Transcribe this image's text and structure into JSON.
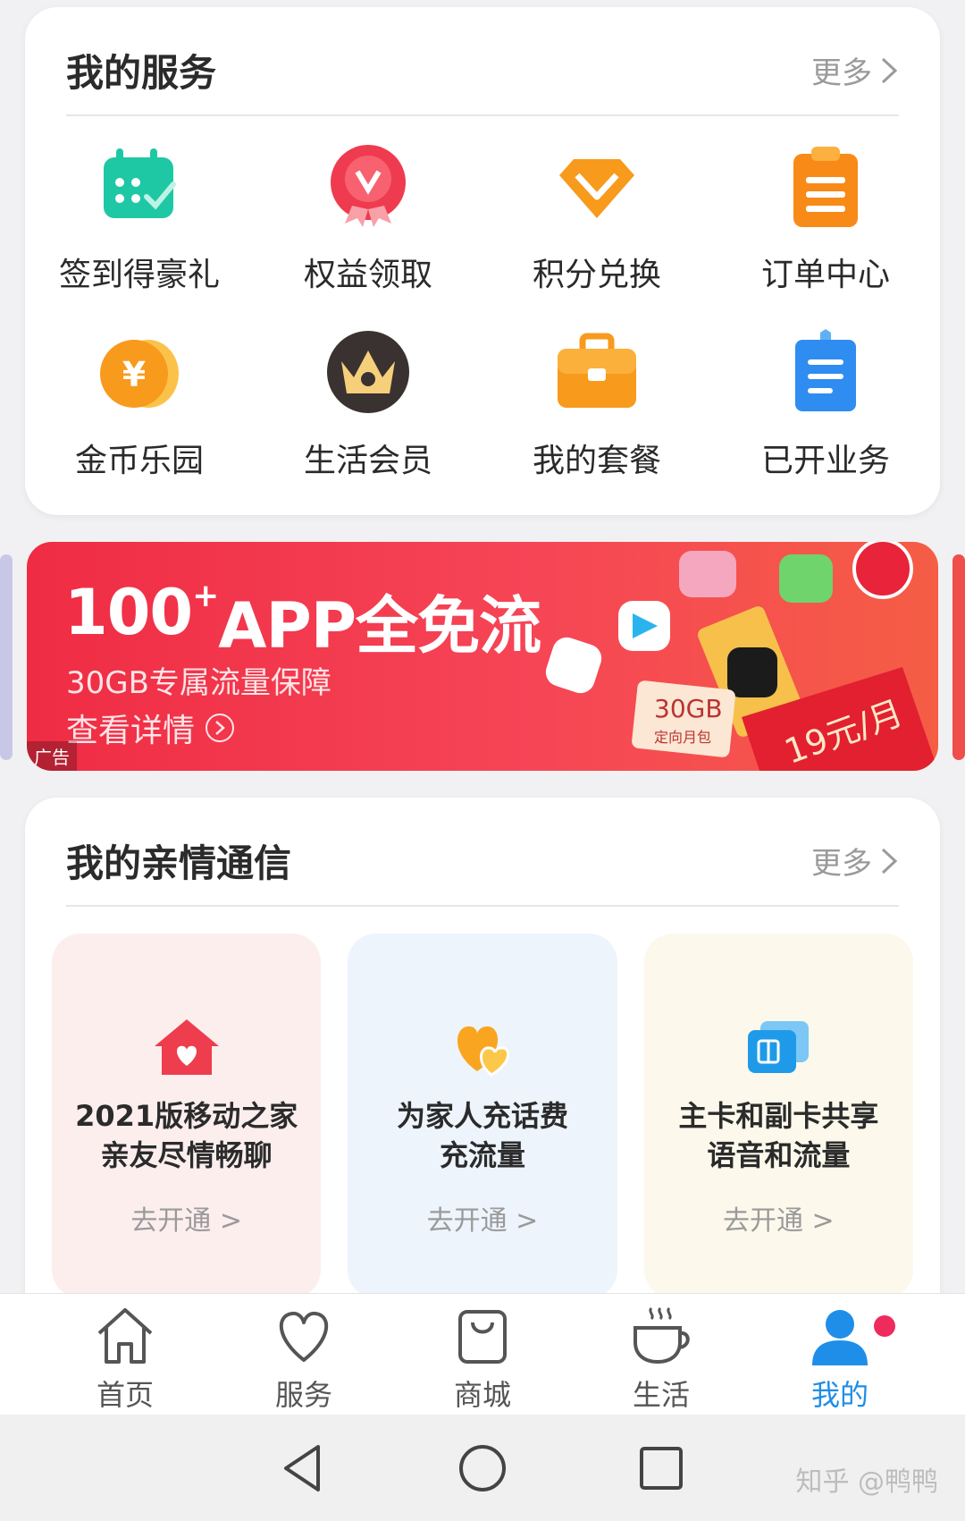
{
  "services": {
    "title": "我的服务",
    "more": "更多",
    "items": [
      {
        "label": "签到得豪礼",
        "icon": "calendar-check-icon"
      },
      {
        "label": "权益领取",
        "icon": "rights-badge-icon"
      },
      {
        "label": "积分兑换",
        "icon": "diamond-icon"
      },
      {
        "label": "订单中心",
        "icon": "clipboard-icon"
      },
      {
        "label": "金币乐园",
        "icon": "coin-icon"
      },
      {
        "label": "生活会员",
        "icon": "crown-icon"
      },
      {
        "label": "我的套餐",
        "icon": "briefcase-icon"
      },
      {
        "label": "已开业务",
        "icon": "document-icon"
      }
    ]
  },
  "banner": {
    "title_main": "100",
    "title_sup": "+",
    "title_rest": "APP全免流",
    "subtitle": "30GB专属流量保障",
    "detail": "查看详情",
    "ad_label": "广告",
    "price": "19元/月",
    "gb_label": "30GB",
    "pack_label": "定向月包"
  },
  "family": {
    "title": "我的亲情通信",
    "more": "更多",
    "features": [
      {
        "line1": "2021版移动之家",
        "line2": "亲友尽情畅聊",
        "cta": "去开通 >",
        "icon": "home-heart-icon",
        "bg": "#fdeeee"
      },
      {
        "line1": "为家人充话费",
        "line2": "充流量",
        "cta": "去开通 >",
        "icon": "hearts-icon",
        "bg": "#edf4fc"
      },
      {
        "line1": "主卡和副卡共享",
        "line2": "语音和流量",
        "cta": "去开通 >",
        "icon": "sim-cards-icon",
        "bg": "#fcf8ec"
      }
    ]
  },
  "tabs": [
    {
      "label": "首页",
      "icon": "home-icon"
    },
    {
      "label": "服务",
      "icon": "heart-icon"
    },
    {
      "label": "商城",
      "icon": "shopping-bag-icon"
    },
    {
      "label": "生活",
      "icon": "coffee-cup-icon"
    },
    {
      "label": "我的",
      "icon": "user-icon",
      "active": true
    }
  ],
  "watermark": "知乎 @鸭鸭",
  "colors": {
    "accent": "#1f8ee8",
    "banner": "#ef2c44",
    "badge": "#ef2a5d"
  }
}
